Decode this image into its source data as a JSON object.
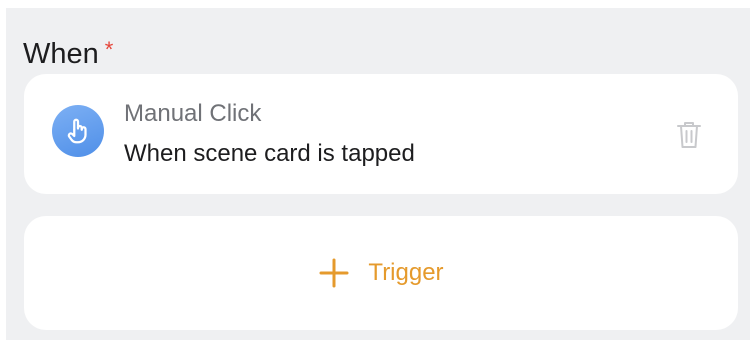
{
  "section": {
    "title": "When",
    "required_mark": "*"
  },
  "trigger": {
    "icon": "hand-pointer-icon",
    "type": "Manual Click",
    "description": "When scene card is tapped",
    "delete_icon": "trash-icon"
  },
  "add_trigger": {
    "icon": "plus-icon",
    "label": "Trigger"
  },
  "colors": {
    "accent": "#e59a2c",
    "icon_blue": "#5a97ec",
    "required": "#e5453a",
    "background": "#eff0f2"
  }
}
